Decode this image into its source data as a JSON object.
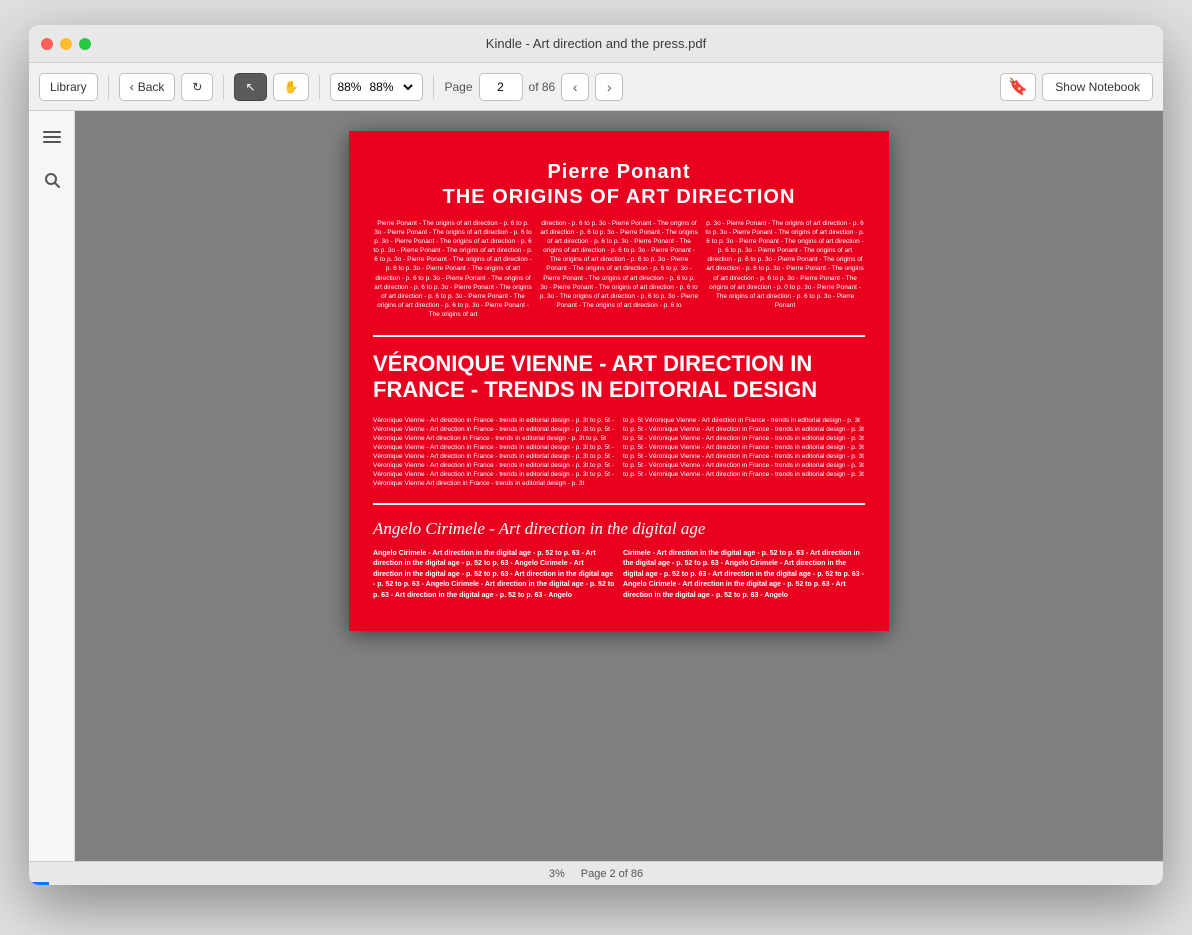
{
  "window": {
    "title": "Kindle - Art direction and the press.pdf"
  },
  "toolbar": {
    "library_label": "Library",
    "back_label": "Back",
    "zoom_value": "88%",
    "page_current": "2",
    "page_total": "86",
    "page_of_label": "of 86",
    "show_notebook_label": "Show Notebook"
  },
  "statusbar": {
    "progress": "3%",
    "page_label": "Page 2 of 86"
  },
  "page": {
    "section1": {
      "title": "Pierre Ponant",
      "subtitle": "The origins of art direction",
      "col1": "Pierre Ponant - The origins of art direction - p. 6 to p. 3o - Pierre Ponant - The origins of art direction - p. 6 to p. 3o - Pierre Ponant - The origins of art direction - p. 6 to p. 3o - Pierre Ponant - The origins of art direction - p. 6 to p. 3o - Pierre Ponant - The origins of art direction - p. 6 to p. 3o - Pierre Ponant - The origins of art direction - p. 6 to p. 3o - Pierre Ponant - The origins of art direction - p. 6 to p. 3o - Pierre Ponant - The origins of art direction - p. 6 to p. 3o - Pierre Ponant - The origins of art direction - p. 6 to p. 3o - Pierre Ponant - The origins of art",
      "col2": "direction - p. 6 to p. 3o - Pierre Ponant - The origins of art direction - p. 6 to p. 3o - Pierre Ponant - The origins of art direction - p. 6 to p. 3o - Pierre Ponant - The origins of art direction - p. 6 to p. 3o - Pierre Ponant - The origins of art direction - p. 6 to p. 3o - Pierre Ponant - The origins of art direction - p. 6 to p. 3o - Pierre Ponant - The origins of art direction - p. 6 to p. 3o - Pierre Ponant - The origins of art direction - p. 6 to p. 3o - The origins of art direction - p. 6 to p. 3o - Pierre Ponant - The origins of art direction - p. 6 to",
      "col3": "p. 3o - Pierre Ponant - The origins of art direction - p. 6 to p. 3o - Pierre Ponant - The origins of art direction - p. 6 to p. 3o - Pierre Ponant - The origins of art direction - p. 6 to p. 3o - Pierre Ponant - The origins of art direction - p. 6 to p. 3o - Pierre Ponant - The origins of art direction - p. 6 to p. 3o - Pierre Ponant - The origins of art direction - p. 6 to p. 3o - Pierre Ponant - The origins of art direction - p. 0 to p. 3o - Pierre Ponant - The origins of art direction - p. 6 to p. 3o - Pierre Ponant"
    },
    "section2": {
      "title": "Véronique Vienne - Art Direction in France - Trends in Editorial Design",
      "col1": "Véronique Vienne - Art direction in France - trends in editorial design - p. 3t to p. 5t - Véronique Vienne - Art direction in France - trends in editorial design - p. 3t to p. 5t - Véronique Vienne Art direction in France - trends in editorial design - p. 3t to p. 5t Véronique Vienne - Art direction in France - trends in editorial design - p. 3t to p. 5t - Véronique Vienne - Art direction in France - trends in editorial design - p. 3t to p. 5t - Véronique Vienne - Art direction in France - trends in editorial design - p. 3t to p. 5t - Véronique Vienne - Art direction in France - trends in editorial design - p. 3t to p. 5t - Véronique Vienne Art direction in France - trends in editorial design - p. 3t",
      "col2": "to p. 5t Véronique Vienne - Art direction in France - trends in editorial design - p. 3t to p. 5t - Véronique Vienne - Art direction in France - trends in editorial design - p. 3t to p. 5t - Véronique Vienne - Art direction in France - trends in editorial design - p. 3t to p. 5t - Véronique Vienne - Art direction in France - trends in editorial design - p. 3t to p. 5t - Véronique Vienne - Art direction in France - trends in editorial design - p. 3t to p. 5t - Véronique Vienne - Art direction in France - trends in editorial design - p. 3t to p. 5t - Véronique Vienne - Art direction in France - trends in editorial design - p. 3t"
    },
    "section3": {
      "title": "Angelo Cirimele - Art direction in the digital age",
      "col1": "Angelo Cirimele - Art direction in the digital age - p. 52 to p. 63 - Art direction in the digital age - p. 52 to p. 63 - Angelo Cirimele - Art direction in the digital age - p. 52 to p. 63 - Art direction in the digital age - p. 52 to p. 63 - Angelo Cirimele - Art direction in the digital age - p. 52 to p. 63 - Art direction in the digital age - p. 52 to p. 63 - Angelo",
      "col2": "Cirimele - Art direction in the digital age - p. 52 to p. 63 - Art direction in the digital age - p. 52 to p. 63 - Angelo Cirimele - Art direction in the digital age - p. 52 to p. 63 - Art direction in the digital age - p. 52 to p. 63 - Angelo Cirimele - Art direction in the digital age - p. 52 to p. 63 - Art direction in the digital age - p. 52 to p. 63 - Angelo"
    }
  }
}
